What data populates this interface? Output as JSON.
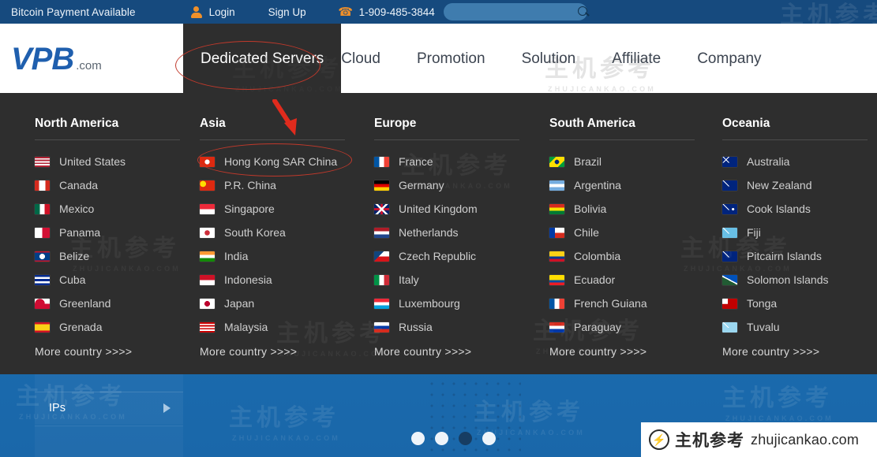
{
  "topbar": {
    "bitcoin_text": "Bitcoin Payment Available",
    "login": "Login",
    "signup": "Sign Up",
    "phone": "1-909-485-3844",
    "search_placeholder": "",
    "search_value": "",
    "user_icon": "user-icon",
    "phone_icon": "phone-icon",
    "search_icon": "search-icon",
    "bg_color": "#164a7e",
    "accent_color": "#f0902a"
  },
  "header": {
    "logo_main": "VPB",
    "logo_suffix": ".com",
    "logo_color": "#1f5fae",
    "nav": [
      {
        "label": "Dedicated Servers",
        "active": true
      },
      {
        "label": "Cloud",
        "active": false
      },
      {
        "label": "Promotion",
        "active": false
      },
      {
        "label": "Solution",
        "active": false
      },
      {
        "label": "Affiliate",
        "active": false
      },
      {
        "label": "Company",
        "active": false
      }
    ]
  },
  "mega_menu": {
    "bg_color": "#2e2e2e",
    "more_label": "More country >>>>",
    "columns": [
      {
        "title": "North America",
        "countries": [
          {
            "name": "United States",
            "flag": "flag-us"
          },
          {
            "name": "Canada",
            "flag": "flag-ca"
          },
          {
            "name": "Mexico",
            "flag": "flag-mx"
          },
          {
            "name": "Panama",
            "flag": "flag-pa"
          },
          {
            "name": "Belize",
            "flag": "flag-bz"
          },
          {
            "name": "Cuba",
            "flag": "flag-cu"
          },
          {
            "name": "Greenland",
            "flag": "flag-gl"
          },
          {
            "name": "Grenada",
            "flag": "flag-gd"
          }
        ]
      },
      {
        "title": "Asia",
        "countries": [
          {
            "name": "Hong Kong SAR China",
            "flag": "flag-hk"
          },
          {
            "name": "P.R. China",
            "flag": "flag-cn"
          },
          {
            "name": "Singapore",
            "flag": "flag-sg"
          },
          {
            "name": "South Korea",
            "flag": "flag-kr"
          },
          {
            "name": "India",
            "flag": "flag-in"
          },
          {
            "name": "Indonesia",
            "flag": "flag-id"
          },
          {
            "name": "Japan",
            "flag": "flag-jp"
          },
          {
            "name": "Malaysia",
            "flag": "flag-my"
          }
        ]
      },
      {
        "title": "Europe",
        "countries": [
          {
            "name": "France",
            "flag": "flag-fr"
          },
          {
            "name": "Germany",
            "flag": "flag-de"
          },
          {
            "name": "United Kingdom",
            "flag": "flag-gb"
          },
          {
            "name": "Netherlands",
            "flag": "flag-nl"
          },
          {
            "name": "Czech Republic",
            "flag": "flag-cz"
          },
          {
            "name": "Italy",
            "flag": "flag-it"
          },
          {
            "name": "Luxembourg",
            "flag": "flag-lu"
          },
          {
            "name": "Russia",
            "flag": "flag-ru"
          }
        ]
      },
      {
        "title": "South America",
        "countries": [
          {
            "name": "Brazil",
            "flag": "flag-br"
          },
          {
            "name": "Argentina",
            "flag": "flag-ar"
          },
          {
            "name": "Bolivia",
            "flag": "flag-bo"
          },
          {
            "name": "Chile",
            "flag": "flag-cl"
          },
          {
            "name": "Colombia",
            "flag": "flag-co"
          },
          {
            "name": "Ecuador",
            "flag": "flag-ec"
          },
          {
            "name": "French Guiana",
            "flag": "flag-gf"
          },
          {
            "name": "Paraguay",
            "flag": "flag-py"
          }
        ]
      },
      {
        "title": "Oceania",
        "countries": [
          {
            "name": "Australia",
            "flag": "flag-au"
          },
          {
            "name": "New Zealand",
            "flag": "flag-nz"
          },
          {
            "name": "Cook Islands",
            "flag": "flag-ck"
          },
          {
            "name": "Fiji",
            "flag": "flag-fj"
          },
          {
            "name": "Pitcairn Islands",
            "flag": "flag-pn"
          },
          {
            "name": "Solomon Islands",
            "flag": "flag-sb"
          },
          {
            "name": "Tonga",
            "flag": "flag-to"
          },
          {
            "name": "Tuvalu",
            "flag": "flag-tv"
          }
        ]
      }
    ]
  },
  "sidebar": {
    "item_label": "IPs",
    "arrow_icon": "chevron-right-icon"
  },
  "carousel": {
    "dot_count": 4,
    "active_index": 2
  },
  "badge": {
    "cn_text": "主机参考",
    "en_text": "zhujicankao.com",
    "logo_icon": "lightning-circle-icon"
  },
  "watermark": {
    "cn": "主机参考",
    "en": "ZHUJICANKAO.COM"
  },
  "annotations": {
    "ellipse_nav": "Dedicated Servers",
    "ellipse_country": "Hong Kong SAR China",
    "arrow_color": "#e02b1d",
    "ellipse_color": "#c0392b"
  }
}
